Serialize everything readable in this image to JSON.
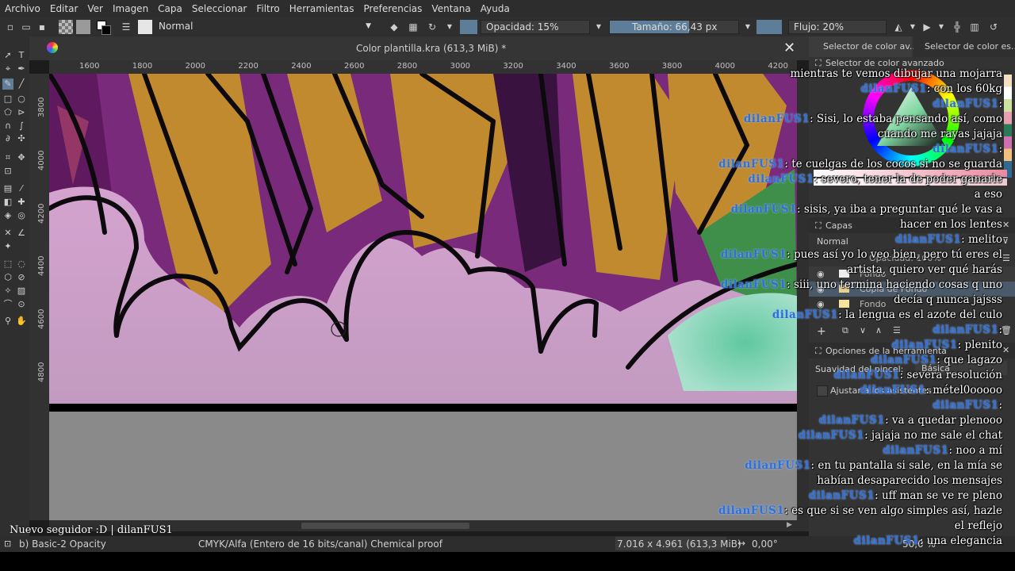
{
  "menu": [
    "Archivo",
    "Editar",
    "Ver",
    "Imagen",
    "Capa",
    "Seleccionar",
    "Filtro",
    "Herramientas",
    "Preferencias",
    "Ventana",
    "Ayuda"
  ],
  "options": {
    "blend_mode": "Normal",
    "opacity": "Opacidad: 15%",
    "size": "Tamaño: 66,43 px",
    "flow": "Flujo: 20%"
  },
  "document": {
    "title": "Color plantilla.kra (613,3 MiB) *"
  },
  "ruler": {
    "top": [
      "1600",
      "1800",
      "2000",
      "2200",
      "2400",
      "2600",
      "2800",
      "3000",
      "3200",
      "3400",
      "3600",
      "3800",
      "4000",
      "4200"
    ],
    "left": [
      "3800",
      "4000",
      "4200",
      "4400",
      "4600",
      "4800"
    ]
  },
  "docker": {
    "tab1": "Selector de color av...",
    "tab2": "Selector de color es...",
    "color_selector_title": "Selector de color avanzado",
    "layers_title": "Capas",
    "layers_blend": "Normal",
    "layers_opacity": "Opacidad: 100%",
    "layers": [
      "Fondo",
      "Copia de Fondo",
      "Fondo"
    ],
    "tool_options_title": "Opciones de la herramienta",
    "smoothing_label": "Suavidad del pincel:",
    "smoothing_value": "Básica",
    "snap_label": "Ajustar a los asistentes"
  },
  "status": {
    "brush": "b) Basic-2 Opacity",
    "color_space": "CMYK/Alfa (Entero de 16 bits/canal)  Chemical proof",
    "dimensions": "7.016 x 4.961 (613,3 MiB)",
    "rotation": "0,00°",
    "zoom": "50,0 %"
  },
  "stream": {
    "follower": "Nuevo seguidor :D | dilanFUS1",
    "chat": [
      {
        "user": "",
        "text": "mientras te vemos dibujar una mojarra"
      },
      {
        "user": "dilanFUS1",
        "text": ": con los 60kg"
      },
      {
        "user": "dilanFUS1",
        "text": ":"
      },
      {
        "user": "dilanFUS1",
        "text": ": Sisi, lo estaba pensando así, como"
      },
      {
        "user": "",
        "text": "cuando me rayas jajaja"
      },
      {
        "user": "dilanFUS1",
        "text": ":"
      },
      {
        "user": "dilanFUS1",
        "text": ": te cuelgas de los cocos si no se guarda"
      },
      {
        "user": "dilanFUS1",
        "text": ": severo, tener la de poder ganarle"
      },
      {
        "user": "",
        "text": "a eso"
      },
      {
        "user": "dilanFUS1",
        "text": ": sisis, ya iba a preguntar qué le vas a"
      },
      {
        "user": "",
        "text": "hacer en los lentes"
      },
      {
        "user": "dilanFUS1",
        "text": ": melito"
      },
      {
        "user": "dilanFUS1",
        "text": ": pues así yo lo veo bien, pero tú eres el"
      },
      {
        "user": "",
        "text": "artista, quiero ver qué harás"
      },
      {
        "user": "dilanFUS1",
        "text": ": siii, uno termina haciendo cosas q uno"
      },
      {
        "user": "",
        "text": "decía q nunca jajsss"
      },
      {
        "user": "dilanFUS1",
        "text": ": la lengua es el azote del culo"
      },
      {
        "user": "dilanFUS1",
        "text": ":"
      },
      {
        "user": "dilanFUS1",
        "text": ": plenito"
      },
      {
        "user": "dilanFUS1",
        "text": ": que lagazo"
      },
      {
        "user": "dilanFUS1",
        "text": ": severa resolución"
      },
      {
        "user": "dilanFUS1",
        "text": ": métel0ooooo"
      },
      {
        "user": "dilanFUS1",
        "text": ":"
      },
      {
        "user": "dilanFUS1",
        "text": ": va a quedar plenooo"
      },
      {
        "user": "dilanFUS1",
        "text": ": jajaja no me sale el chat"
      },
      {
        "user": "dilanFUS1",
        "text": ": noo a mí"
      },
      {
        "user": "dilanFUS1",
        "text": ": en tu pantalla si sale, en la mía se"
      },
      {
        "user": "",
        "text": "habían desaparecido los mensajes"
      },
      {
        "user": "dilanFUS1",
        "text": ": uff man se ve re pleno"
      },
      {
        "user": "dilanFUS1",
        "text": ": es que si se ven algo simples así, hazle"
      },
      {
        "user": "",
        "text": "el reflejo"
      },
      {
        "user": "dilanFUS1",
        "text": ": una elegancia"
      }
    ]
  }
}
